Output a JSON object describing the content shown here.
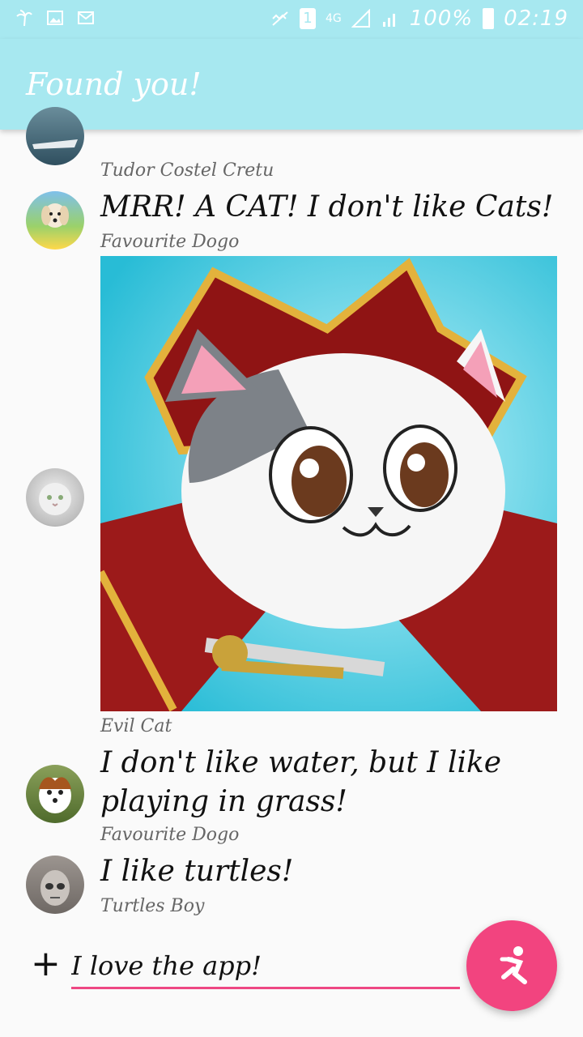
{
  "status_bar": {
    "network": "4G",
    "sim_slot": "1",
    "battery": "100%",
    "time": "02:19",
    "left_icons": [
      "palm-tree-icon",
      "image-icon",
      "mail-icon"
    ],
    "right_icons": [
      "mute-icon",
      "sim-icon",
      "signal-icon",
      "signal-icon-2",
      "battery-icon"
    ]
  },
  "app_bar": {
    "title": "Found you!"
  },
  "messages": [
    {
      "text": "",
      "name": "Tudor Costel Cretu"
    },
    {
      "text": "MRR! A CAT! I don't like Cats!",
      "name": "Favourite Dogo"
    },
    {
      "text": "",
      "name": "Evil Cat",
      "has_image": true
    },
    {
      "text_line1": "I don't like water, but I like",
      "text_line2": "playing in grass!",
      "name": "Favourite Dogo"
    },
    {
      "text": "I like turtles!",
      "name": "Turtles Boy"
    }
  ],
  "input": {
    "value": "I love the app!",
    "add_icon": "+"
  },
  "fab": {
    "icon": "runner-icon"
  },
  "colors": {
    "bar": "#a7e8f0",
    "accent": "#f2447f",
    "underline": "#ee4783"
  }
}
